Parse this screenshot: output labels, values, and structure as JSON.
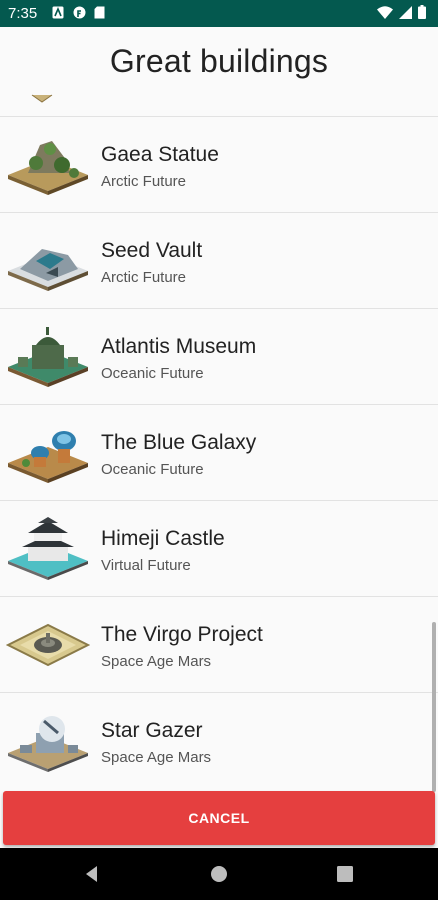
{
  "status_bar": {
    "time": "7:35",
    "left_icons": [
      "notification-a-icon",
      "notification-f-icon",
      "sd-card-icon"
    ],
    "right_icons": [
      "wifi-icon",
      "cellular-icon",
      "battery-icon"
    ]
  },
  "dialog": {
    "title": "Great buildings",
    "items": [
      {
        "name": "Gaea Statue",
        "era": "Arctic Future",
        "thumb": "gaea-statue-icon"
      },
      {
        "name": "Seed Vault",
        "era": "Arctic Future",
        "thumb": "seed-vault-icon"
      },
      {
        "name": "Atlantis Museum",
        "era": "Oceanic Future",
        "thumb": "atlantis-museum-icon"
      },
      {
        "name": "The Blue Galaxy",
        "era": "Oceanic Future",
        "thumb": "blue-galaxy-icon"
      },
      {
        "name": "Himeji Castle",
        "era": "Virtual Future",
        "thumb": "himeji-castle-icon"
      },
      {
        "name": "The Virgo Project",
        "era": "Space Age Mars",
        "thumb": "virgo-project-icon"
      },
      {
        "name": "Star Gazer",
        "era": "Space Age Mars",
        "thumb": "star-gazer-icon"
      }
    ],
    "cancel_label": "CANCEL"
  },
  "colors": {
    "status_bar": "#04594f",
    "cancel": "#e53f3f",
    "nav_bar": "#000000"
  },
  "nav_bar": {
    "buttons": [
      "back-icon",
      "home-icon",
      "recents-icon"
    ]
  }
}
